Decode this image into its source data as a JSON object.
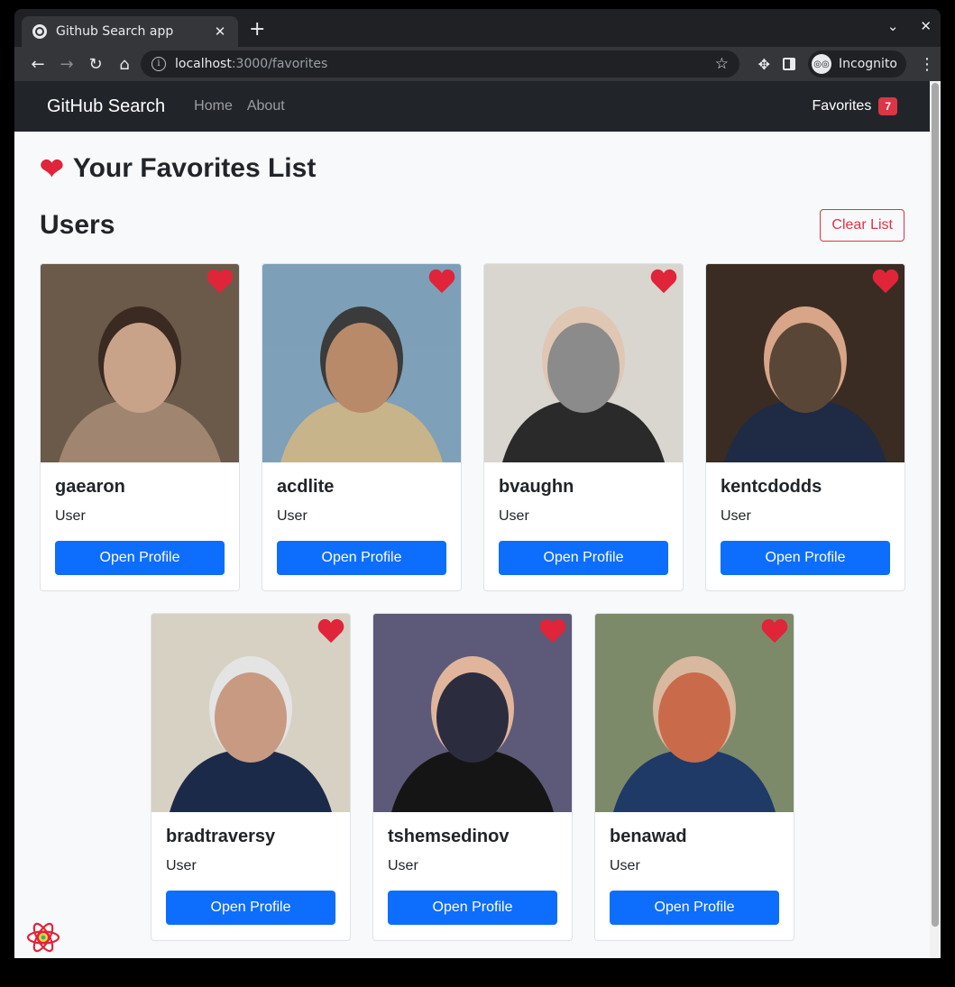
{
  "browser": {
    "tab_title": "Github Search app",
    "url_host": "localhost",
    "url_rest": ":3000/favorites",
    "profile_label": "Incognito"
  },
  "navbar": {
    "brand": "GitHub Search",
    "links": [
      "Home",
      "About"
    ],
    "favorites_label": "Favorites",
    "favorites_count": "7"
  },
  "page": {
    "title": "Your Favorites List",
    "section_title": "Users",
    "clear_button": "Clear List"
  },
  "users": [
    {
      "login": "gaearon",
      "type": "User",
      "button": "Open Profile"
    },
    {
      "login": "acdlite",
      "type": "User",
      "button": "Open Profile"
    },
    {
      "login": "bvaughn",
      "type": "User",
      "button": "Open Profile"
    },
    {
      "login": "kentcdodds",
      "type": "User",
      "button": "Open Profile"
    },
    {
      "login": "bradtraversy",
      "type": "User",
      "button": "Open Profile"
    },
    {
      "login": "tshemsedinov",
      "type": "User",
      "button": "Open Profile"
    },
    {
      "login": "benawad",
      "type": "User",
      "button": "Open Profile"
    }
  ],
  "colors": {
    "primary": "#0d6efd",
    "danger": "#dc3545",
    "heart": "#e0243a",
    "navbar": "#212529"
  },
  "icons": {
    "favorite": "heart-icon",
    "devtools": "react-logo-icon"
  }
}
